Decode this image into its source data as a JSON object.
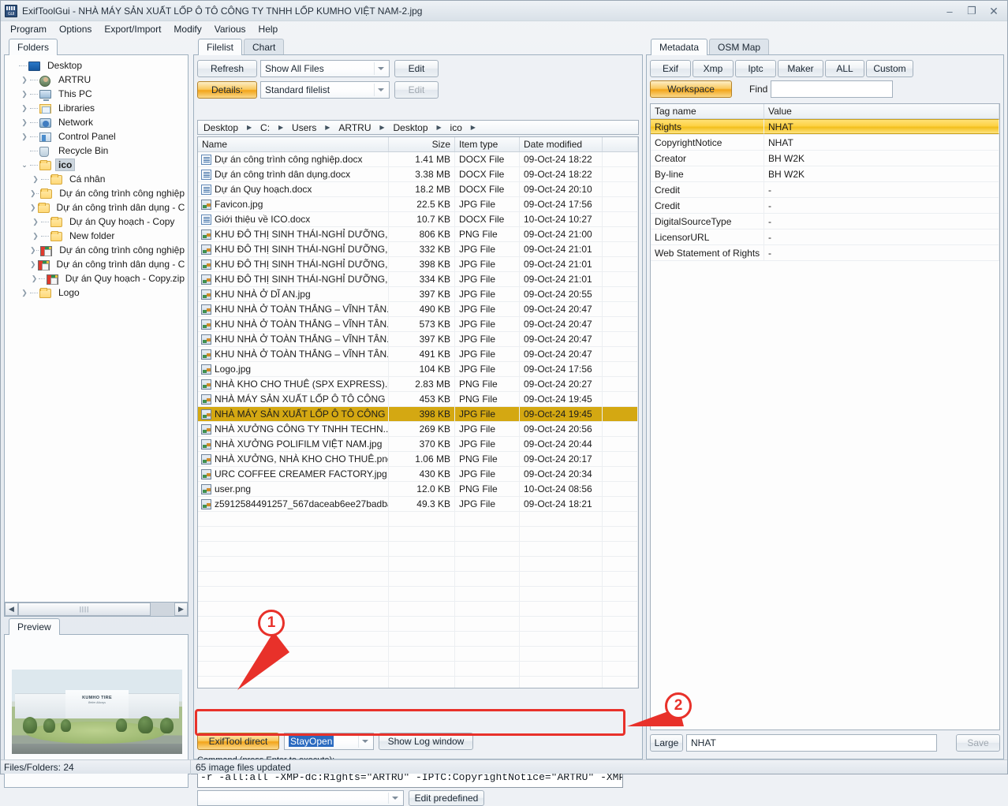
{
  "window": {
    "title": "ExifToolGui - NHÀ MÁY SẢN XUẤT LỐP Ô TÔ CÔNG TY TNHH LỐP KUMHO VIỆT NAM-2.jpg",
    "minimize": "–",
    "maximize": "❐",
    "close": "✕"
  },
  "menu": [
    "Program",
    "Options",
    "Export/Import",
    "Modify",
    "Various",
    "Help"
  ],
  "left": {
    "tab": "Folders",
    "preview_tab": "Preview",
    "tree": [
      {
        "label": "Desktop",
        "icon": "desktop-icon",
        "indent": 0,
        "expander": "",
        "selected": false
      },
      {
        "label": "ARTRU",
        "icon": "user-icon",
        "indent": 1,
        "expander": "›",
        "selected": false
      },
      {
        "label": "This PC",
        "icon": "pc-icon",
        "indent": 1,
        "expander": "›",
        "selected": false
      },
      {
        "label": "Libraries",
        "icon": "library-icon",
        "indent": 1,
        "expander": "›",
        "selected": false
      },
      {
        "label": "Network",
        "icon": "network-icon",
        "indent": 1,
        "expander": "›",
        "selected": false
      },
      {
        "label": "Control Panel",
        "icon": "control-panel-icon",
        "indent": 1,
        "expander": "›",
        "selected": false
      },
      {
        "label": "Recycle Bin",
        "icon": "recycle-bin-icon",
        "indent": 1,
        "expander": "",
        "selected": false
      },
      {
        "label": "ico",
        "icon": "folder-icon",
        "indent": 1,
        "expander": "⌄",
        "selected": true
      },
      {
        "label": "Cá nhân",
        "icon": "folder-icon",
        "indent": 2,
        "expander": "›",
        "selected": false
      },
      {
        "label": "Dự án công trình công nghiệp",
        "icon": "folder-icon",
        "indent": 2,
        "expander": "›",
        "selected": false
      },
      {
        "label": "Dự án công trình dân dụng - C",
        "icon": "folder-icon",
        "indent": 2,
        "expander": "›",
        "selected": false
      },
      {
        "label": "Dự án Quy hoạch - Copy",
        "icon": "folder-icon",
        "indent": 2,
        "expander": "›",
        "selected": false
      },
      {
        "label": "New folder",
        "icon": "folder-icon",
        "indent": 2,
        "expander": "›",
        "selected": false
      },
      {
        "label": "Dự án công trình công nghiệp",
        "icon": "zip-icon",
        "indent": 2,
        "expander": "›",
        "selected": false
      },
      {
        "label": "Dự án công trình dân dụng - C",
        "icon": "zip-icon",
        "indent": 2,
        "expander": "›",
        "selected": false
      },
      {
        "label": "Dự án Quy hoạch - Copy.zip",
        "icon": "zip-icon",
        "indent": 2,
        "expander": "›",
        "selected": false
      },
      {
        "label": "Logo",
        "icon": "folder-icon",
        "indent": 1,
        "expander": "›",
        "selected": false
      }
    ],
    "scroll_left_arrow": "◀",
    "scroll_right_arrow": "▶",
    "preview_caption": "KUMHO TIRE"
  },
  "middle": {
    "tabs": [
      {
        "label": "Filelist",
        "active": true
      },
      {
        "label": "Chart",
        "active": false
      }
    ],
    "refresh_button": "Refresh",
    "filter_combo": "Show All Files",
    "edit_button_1": "Edit",
    "details_button": "Details:",
    "details_combo": "Standard filelist",
    "edit_button_2": "Edit",
    "breadcrumb": [
      "Desktop",
      "C:",
      "Users",
      "ARTRU",
      "Desktop",
      "ico"
    ],
    "columns": [
      "Name",
      "Size",
      "Item type",
      "Date modified"
    ],
    "files": [
      {
        "name": "Dự án công trình công nghiệp.docx",
        "size": "1.41 MB",
        "type": "DOCX File",
        "date": "09-Oct-24 18:22",
        "icon": "docx",
        "selected": false
      },
      {
        "name": "Dự án công trình dân dụng.docx",
        "size": "3.38 MB",
        "type": "DOCX File",
        "date": "09-Oct-24 18:22",
        "icon": "docx",
        "selected": false
      },
      {
        "name": "Dự án Quy hoạch.docx",
        "size": "18.2 MB",
        "type": "DOCX File",
        "date": "09-Oct-24 20:10",
        "icon": "docx",
        "selected": false
      },
      {
        "name": "Favicon.jpg",
        "size": "22.5 KB",
        "type": "JPG File",
        "date": "09-Oct-24 17:56",
        "icon": "img",
        "selected": false
      },
      {
        "name": "Giới thiệu về ICO.docx",
        "size": "10.7 KB",
        "type": "DOCX File",
        "date": "10-Oct-24 10:27",
        "icon": "docx",
        "selected": false
      },
      {
        "name": "KHU ĐÔ THỊ SINH THÁI-NGHỈ DƯỠNG,...",
        "size": "806 KB",
        "type": "PNG File",
        "date": "09-Oct-24 21:00",
        "icon": "img",
        "selected": false
      },
      {
        "name": "KHU ĐÔ THỊ SINH THÁI-NGHỈ DƯỠNG,...",
        "size": "332 KB",
        "type": "JPG File",
        "date": "09-Oct-24 21:01",
        "icon": "img",
        "selected": false
      },
      {
        "name": "KHU ĐÔ THỊ SINH THÁI-NGHỈ DƯỠNG,...",
        "size": "398 KB",
        "type": "JPG File",
        "date": "09-Oct-24 21:01",
        "icon": "img",
        "selected": false
      },
      {
        "name": "KHU ĐÔ THỊ SINH THÁI-NGHỈ DƯỠNG,...",
        "size": "334 KB",
        "type": "JPG File",
        "date": "09-Oct-24 21:01",
        "icon": "img",
        "selected": false
      },
      {
        "name": "KHU NHÀ Ở DĨ AN.jpg",
        "size": "397 KB",
        "type": "JPG File",
        "date": "09-Oct-24 20:55",
        "icon": "img",
        "selected": false
      },
      {
        "name": "KHU NHÀ Ở TOÀN THẮNG – VĨNH TÂN...",
        "size": "490 KB",
        "type": "JPG File",
        "date": "09-Oct-24 20:47",
        "icon": "img",
        "selected": false
      },
      {
        "name": "KHU NHÀ Ở TOÀN THẮNG – VĨNH TÂN...",
        "size": "573 KB",
        "type": "JPG File",
        "date": "09-Oct-24 20:47",
        "icon": "img",
        "selected": false
      },
      {
        "name": "KHU NHÀ Ở TOÀN THẮNG – VĨNH TÂN...",
        "size": "397 KB",
        "type": "JPG File",
        "date": "09-Oct-24 20:47",
        "icon": "img",
        "selected": false
      },
      {
        "name": "KHU NHÀ Ở TOÀN THẮNG – VĨNH TÂN...",
        "size": "491 KB",
        "type": "JPG File",
        "date": "09-Oct-24 20:47",
        "icon": "img",
        "selected": false
      },
      {
        "name": "Logo.jpg",
        "size": "104 KB",
        "type": "JPG File",
        "date": "09-Oct-24 17:56",
        "icon": "img",
        "selected": false
      },
      {
        "name": "NHÀ KHO CHO THUÊ (SPX EXPRESS).png",
        "size": "2.83 MB",
        "type": "PNG File",
        "date": "09-Oct-24 20:27",
        "icon": "img",
        "selected": false
      },
      {
        "name": "NHÀ MÁY SẢN XUẤT LỐP Ô TÔ CÔNG ...",
        "size": "453 KB",
        "type": "PNG File",
        "date": "09-Oct-24 19:45",
        "icon": "img",
        "selected": false
      },
      {
        "name": "NHÀ MÁY SẢN XUẤT LỐP Ô TÔ CÔNG ...",
        "size": "398 KB",
        "type": "JPG File",
        "date": "09-Oct-24 19:45",
        "icon": "img",
        "selected": true
      },
      {
        "name": "NHÀ XƯỞNG CÔNG TY TNHH TECHN...",
        "size": "269 KB",
        "type": "JPG File",
        "date": "09-Oct-24 20:56",
        "icon": "img",
        "selected": false
      },
      {
        "name": "NHÀ XƯỞNG POLIFILM VIỆT NAM.jpg",
        "size": "370 KB",
        "type": "JPG File",
        "date": "09-Oct-24 20:44",
        "icon": "img",
        "selected": false
      },
      {
        "name": "NHÀ XƯỞNG, NHÀ KHO CHO THUÊ.png",
        "size": "1.06 MB",
        "type": "PNG File",
        "date": "09-Oct-24 20:17",
        "icon": "img",
        "selected": false
      },
      {
        "name": "URC COFFEE CREAMER FACTORY.jpg",
        "size": "430 KB",
        "type": "JPG File",
        "date": "09-Oct-24 20:34",
        "icon": "img",
        "selected": false
      },
      {
        "name": "user.png",
        "size": "12.0 KB",
        "type": "PNG File",
        "date": "10-Oct-24 08:56",
        "icon": "img",
        "selected": false
      },
      {
        "name": "z5912584491257_567daceab6ee27badba...",
        "size": "49.3 KB",
        "type": "JPG File",
        "date": "09-Oct-24 18:21",
        "icon": "img",
        "selected": false
      }
    ],
    "exiftool_button": "ExifTool direct",
    "stayopen_combo": "StayOpen",
    "showlog_button": "Show Log window",
    "command_label": "Command (press Enter to execute):",
    "command_value": "-r -all:all -XMP-dc:Rights=\"ARTRU\" -IPTC:CopyrightNotice=\"ARTRU\" -XMP-dc:Cre",
    "predefined_combo": "",
    "edit_predefined_button": "Edit predefined"
  },
  "right": {
    "tabs": [
      {
        "label": "Metadata",
        "active": true
      },
      {
        "label": "OSM Map",
        "active": false
      }
    ],
    "group_buttons": [
      "Exif",
      "Xmp",
      "Iptc",
      "Maker",
      "ALL",
      "Custom"
    ],
    "workspace_button": "Workspace",
    "find_label": "Find",
    "find_value": "",
    "columns": [
      "Tag name",
      "Value"
    ],
    "rows": [
      {
        "tag": "Rights",
        "value": "NHAT",
        "selected": true
      },
      {
        "tag": "CopyrightNotice",
        "value": "NHAT",
        "selected": false
      },
      {
        "tag": "Creator",
        "value": "BH W2K",
        "selected": false
      },
      {
        "tag": "By-line",
        "value": "BH W2K",
        "selected": false
      },
      {
        "tag": "Credit",
        "value": "-",
        "selected": false
      },
      {
        "tag": "Credit",
        "value": "-",
        "selected": false
      },
      {
        "tag": "DigitalSourceType",
        "value": "-",
        "selected": false
      },
      {
        "tag": "LicensorURL",
        "value": "-",
        "selected": false
      },
      {
        "tag": "Web Statement of Rights",
        "value": "-",
        "selected": false
      }
    ],
    "large_button": "Large",
    "value_input": "NHAT",
    "save_button": "Save"
  },
  "status": {
    "files_folders": "Files/Folders: 24",
    "message": "65 image files updated"
  },
  "annotations": [
    {
      "id": "1",
      "label": "1"
    },
    {
      "id": "2",
      "label": "2"
    }
  ],
  "colors": {
    "accent_gold": "#f2a41a",
    "selection_gold": "#d4a812",
    "annotation_red": "#e8312a"
  }
}
